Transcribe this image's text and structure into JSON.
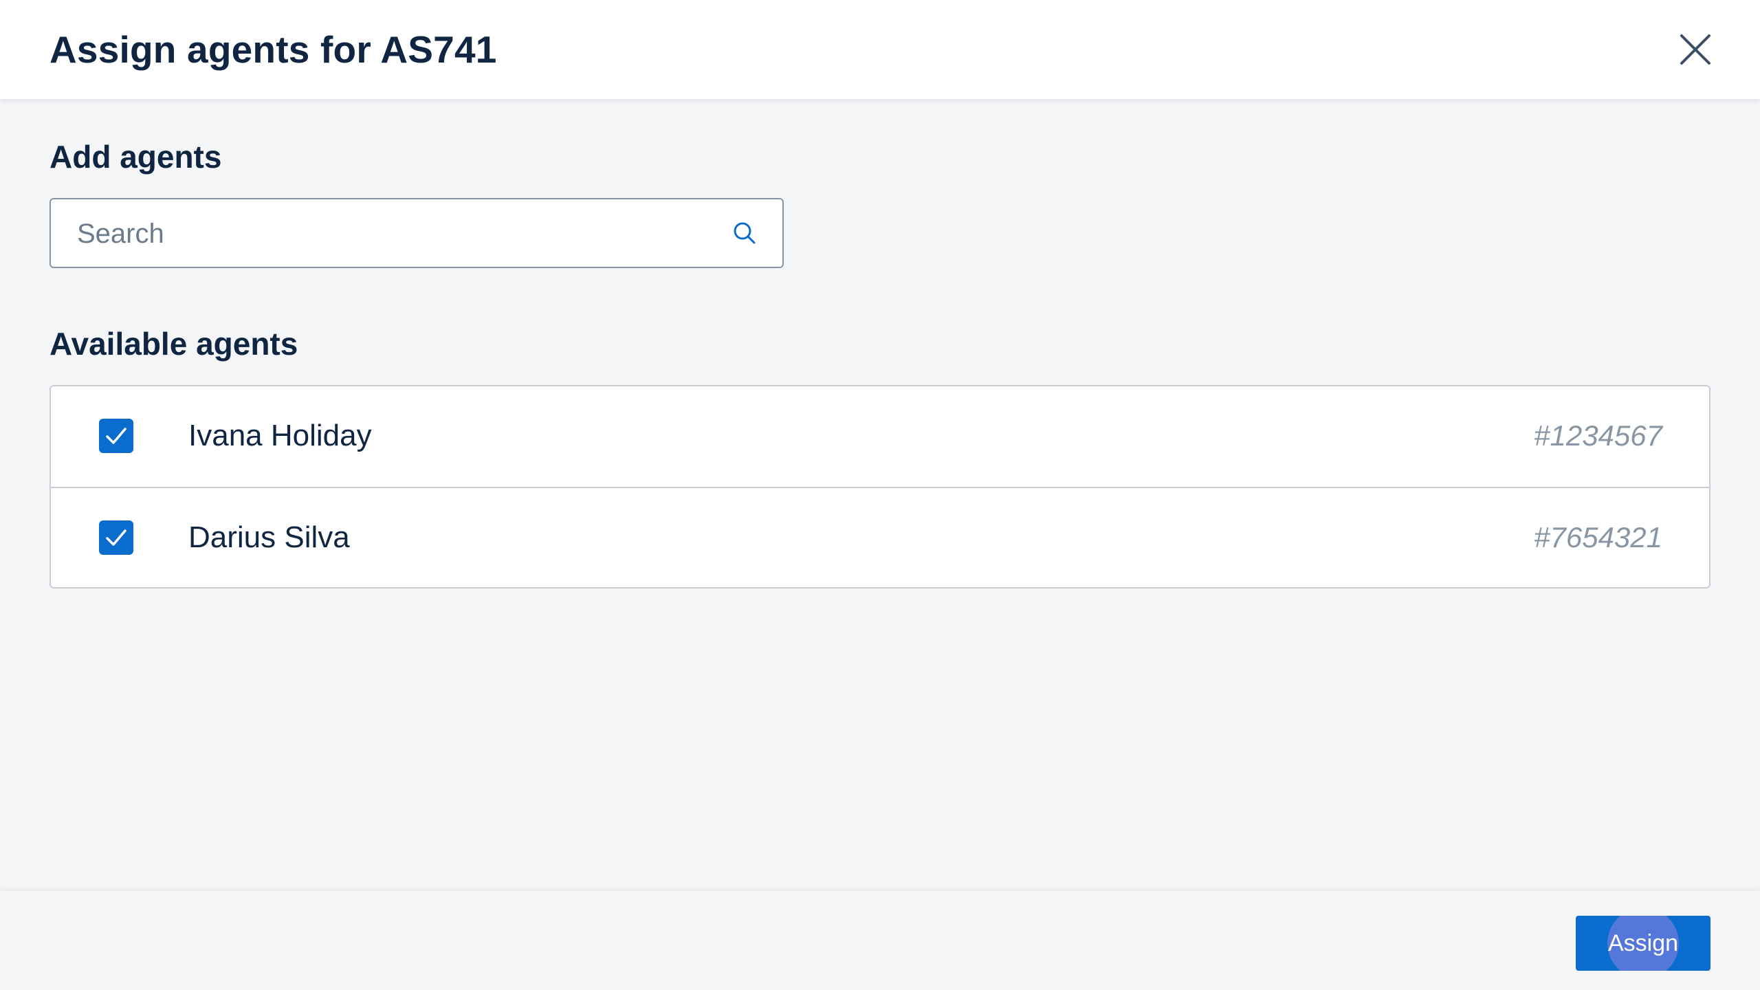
{
  "header": {
    "title": "Assign agents for AS741",
    "close_icon": "close-icon"
  },
  "add_agents": {
    "heading": "Add agents",
    "search": {
      "placeholder": "Search",
      "value": "",
      "icon": "search-icon"
    }
  },
  "available_agents": {
    "heading": "Available agents",
    "items": [
      {
        "name": "Ivana Holiday",
        "id": "#1234567",
        "checked": true
      },
      {
        "name": "Darius Silva",
        "id": "#7654321",
        "checked": true
      }
    ]
  },
  "footer": {
    "assign_label": "Assign"
  },
  "colors": {
    "primary": "#0a6ccd",
    "text": "#0f2541",
    "muted": "#8a95a3",
    "background": "#f4f5f7",
    "border": "#c8cdd4"
  }
}
